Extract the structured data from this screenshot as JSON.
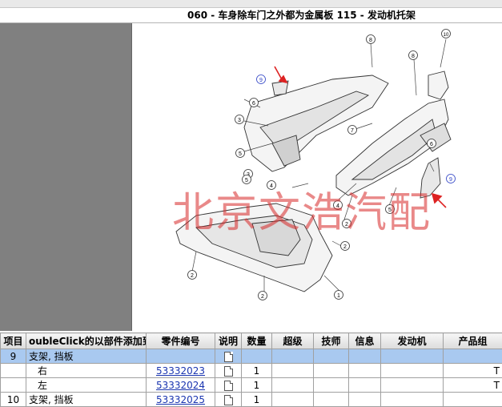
{
  "window": {
    "title": "060 - 车身除车门之外都为金属板 115 - 发动机托架"
  },
  "diagram": {
    "callouts": [
      "1",
      "2",
      "2",
      "2",
      "2",
      "3",
      "3",
      "4",
      "4",
      "5",
      "5",
      "5",
      "6",
      "6",
      "7",
      "8",
      "8",
      "9",
      "9",
      "10"
    ]
  },
  "watermark": {
    "text": "北京文浩汽配"
  },
  "table": {
    "columns": [
      "项目",
      "oubleClick的以部件添加到:",
      "零件编号",
      "说明",
      "数量",
      "超级",
      "技师",
      "信息",
      "发动机",
      "产品组"
    ],
    "rows": [
      {
        "item": "9",
        "name": "支架, 挡板",
        "part": "",
        "desc_icon": "document-icon",
        "qty": "",
        "super": "",
        "tech": "",
        "info": "",
        "engine": "",
        "group": "",
        "selected": true
      },
      {
        "item": "",
        "name": "右",
        "part": "53332023",
        "desc_icon": "document-icon",
        "qty": "1",
        "super": "",
        "tech": "",
        "info": "",
        "engine": "",
        "group": "T",
        "selected": false
      },
      {
        "item": "",
        "name": "左",
        "part": "53332024",
        "desc_icon": "document-icon",
        "qty": "1",
        "super": "",
        "tech": "",
        "info": "",
        "engine": "",
        "group": "T",
        "selected": false
      },
      {
        "item": "10",
        "name": "支架, 挡板",
        "part": "53332025",
        "desc_icon": "document-icon",
        "qty": "1",
        "super": "",
        "tech": "",
        "info": "",
        "engine": "",
        "group": "",
        "selected": false
      }
    ]
  }
}
